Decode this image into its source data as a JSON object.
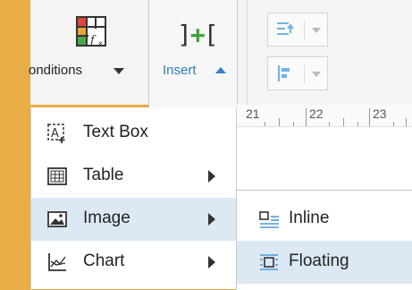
{
  "toolbar": {
    "conditions_label": "onditions",
    "insert_label": "Insert",
    "cond_icon": "formula-table-icon",
    "insert_icon": "insert-bracket-icon"
  },
  "ruler": {
    "numbers": [
      "21",
      "22",
      "23"
    ]
  },
  "menu": {
    "items": [
      {
        "label": "Text Box",
        "icon": "text-box-icon"
      },
      {
        "label": "Table",
        "icon": "table-icon"
      },
      {
        "label": "Image",
        "icon": "image-icon"
      },
      {
        "label": "Chart",
        "icon": "chart-icon"
      }
    ]
  },
  "submenu": {
    "items": [
      {
        "label": "Inline",
        "icon": "inline-image-icon"
      },
      {
        "label": "Floating",
        "icon": "floating-image-icon"
      }
    ]
  },
  "colors": {
    "accent": "#2f7ec2",
    "highlight": "#dce9f5",
    "background": "#e8ad46"
  }
}
